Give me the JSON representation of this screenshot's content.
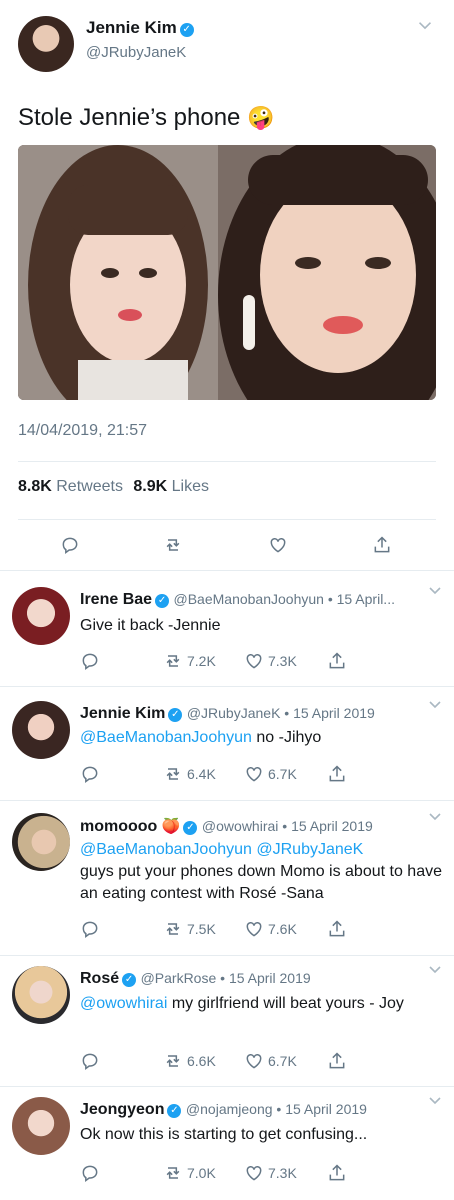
{
  "main_tweet": {
    "name": "Jennie Kim",
    "handle": "@JRubyJaneK",
    "text": "Stole Jennie’s phone",
    "emoji": "🤪",
    "timestamp": "14/04/2019, 21:57",
    "retweets_count": "8.8K",
    "retweets_label": "Retweets",
    "likes_count": "8.9K",
    "likes_label": "Likes"
  },
  "replies": [
    {
      "name": "Irene Bae",
      "handle_meta": "@BaeManobanJoohyun • 15 April...",
      "text": "Give it back -Jennie",
      "retweets": "7.2K",
      "likes": "7.3K"
    },
    {
      "name": "Jennie Kim",
      "handle_meta": "@JRubyJaneK • 15 April 2019",
      "mention": "@BaeManobanJoohyun",
      "text": " no -Jihyo",
      "retweets": "6.4K",
      "likes": "6.7K"
    },
    {
      "name": "momoooo",
      "emoji": "🍑",
      "handle_meta": "@owowhirai • 15 April 2019",
      "mention": "@BaeManobanJoohyun @JRubyJaneK",
      "text": "guys put your phones down Momo is about to have an eating contest with Rosé -Sana",
      "retweets": "7.5K",
      "likes": "7.6K"
    },
    {
      "name": "Rosé",
      "handle_meta": "@ParkRose • 15 April 2019",
      "mention": "@owowhirai",
      "text": " my girlfriend will beat yours - Joy",
      "retweets": "6.6K",
      "likes": "6.7K"
    },
    {
      "name": "Jeongyeon",
      "handle_meta": "@nojamjeong • 15 April 2019",
      "text": "Ok now this is starting to get confusing...",
      "retweets": "7.0K",
      "likes": "7.3K"
    }
  ],
  "icons": {
    "reply": "reply-icon",
    "retweet": "retweet-icon",
    "like": "heart-icon",
    "share": "share-icon",
    "verified": "verified-badge-icon",
    "more": "chevron-down-icon"
  },
  "colors": {
    "accent": "#1da1f2",
    "muted": "#657786",
    "divider": "#e6ecf0"
  }
}
